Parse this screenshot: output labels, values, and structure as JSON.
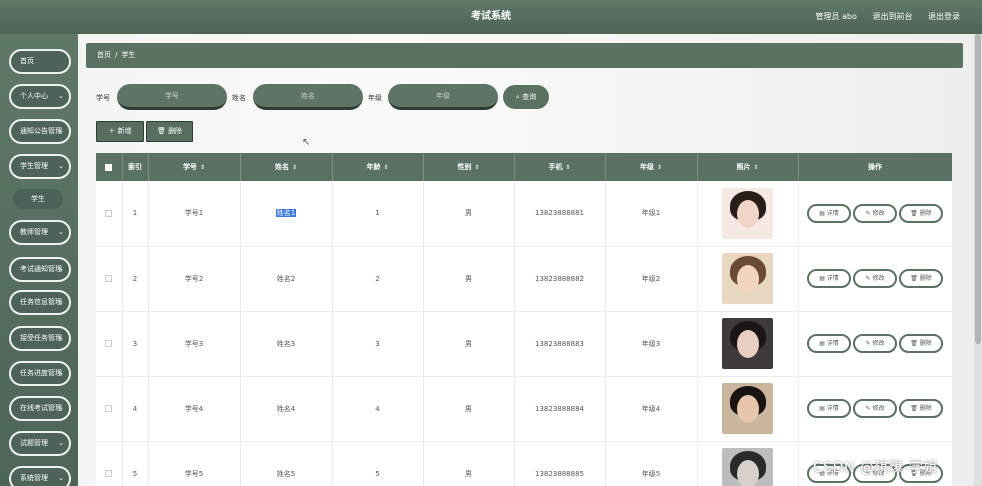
{
  "header": {
    "title": "考试系统",
    "user": "管理员 abo",
    "back_front": "退出到前台",
    "logout": "退出登录"
  },
  "sidebar": {
    "items": [
      {
        "label": "首页",
        "chev": ""
      },
      {
        "label": "个人中心",
        "chev": "⌄"
      },
      {
        "label": "通知公告管理",
        "chev": "⌄"
      },
      {
        "label": "学生管理",
        "chev": "⌄"
      },
      {
        "label": "教师管理",
        "chev": "⌄"
      },
      {
        "label": "考试通知管理",
        "chev": "⌄"
      },
      {
        "label": "任务信息管理",
        "chev": "⌄"
      },
      {
        "label": "接受任务管理",
        "chev": "⌄"
      },
      {
        "label": "任务进度管理",
        "chev": "⌄"
      },
      {
        "label": "在线考试管理",
        "chev": "⌄"
      },
      {
        "label": "试题管理",
        "chev": "⌄"
      },
      {
        "label": "系统管理",
        "chev": "⌄"
      }
    ],
    "sub_item": "学生"
  },
  "breadcrumb": {
    "home": "首页",
    "sep": "/",
    "current": "学生"
  },
  "search": {
    "student_no_label": "学号",
    "student_no_placeholder": "学号",
    "name_label": "姓名",
    "name_placeholder": "姓名",
    "grade_label": "年级",
    "grade_placeholder": "年级",
    "query_label": "查询"
  },
  "actions": {
    "add_label": "新增",
    "delete_label": "删除"
  },
  "table": {
    "headers": [
      "索引",
      "学号",
      "姓名",
      "年龄",
      "性别",
      "手机",
      "年级",
      "照片",
      "操作"
    ],
    "rows": [
      {
        "index": "1",
        "student_no": "学号1",
        "name": "姓名1",
        "age": "1",
        "gender": "男",
        "phone": "13823888881",
        "grade": "年级1"
      },
      {
        "index": "2",
        "student_no": "学号2",
        "name": "姓名2",
        "age": "2",
        "gender": "男",
        "phone": "13823888882",
        "grade": "年级2"
      },
      {
        "index": "3",
        "student_no": "学号3",
        "name": "姓名3",
        "age": "3",
        "gender": "男",
        "phone": "13823888883",
        "grade": "年级3"
      },
      {
        "index": "4",
        "student_no": "学号4",
        "name": "姓名4",
        "age": "4",
        "gender": "男",
        "phone": "13823888884",
        "grade": "年级4"
      },
      {
        "index": "5",
        "student_no": "学号5",
        "name": "姓名5",
        "age": "5",
        "gender": "男",
        "phone": "13823888885",
        "grade": "年级5"
      }
    ],
    "op_detail": "详情",
    "op_edit": "修改",
    "op_delete": "删除"
  },
  "watermark": "CSDN @琪琪-学姐",
  "colors": {
    "primary": "#5b7263",
    "header": "#4b6456",
    "highlight": "#3b78e7"
  }
}
